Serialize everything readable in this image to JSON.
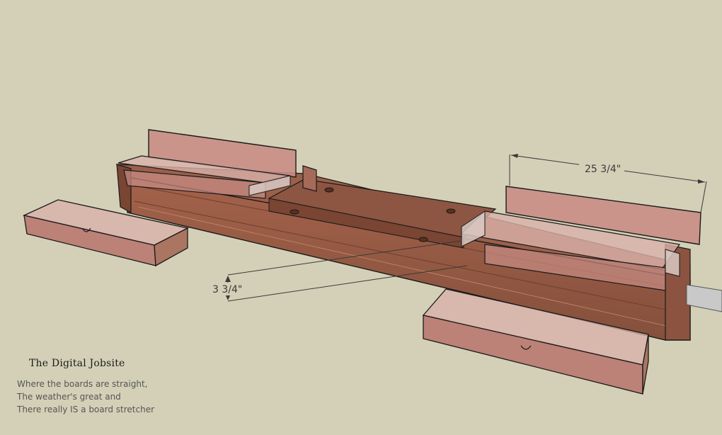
{
  "dimensions": {
    "length_label": "25 3/4\"",
    "height_label": "3 3/4\""
  },
  "caption": {
    "brand": "The Digital Jobsite",
    "lines": [
      "Where the boards are straight,",
      "The weather's great and",
      "There really IS a board stretcher"
    ]
  },
  "colors": {
    "background": "#d3d0b7",
    "wood": "#9c5f48",
    "wood_dark": "#6e3d2c",
    "transparent_panel": "#c98d86",
    "outline": "#1a1a1a"
  }
}
